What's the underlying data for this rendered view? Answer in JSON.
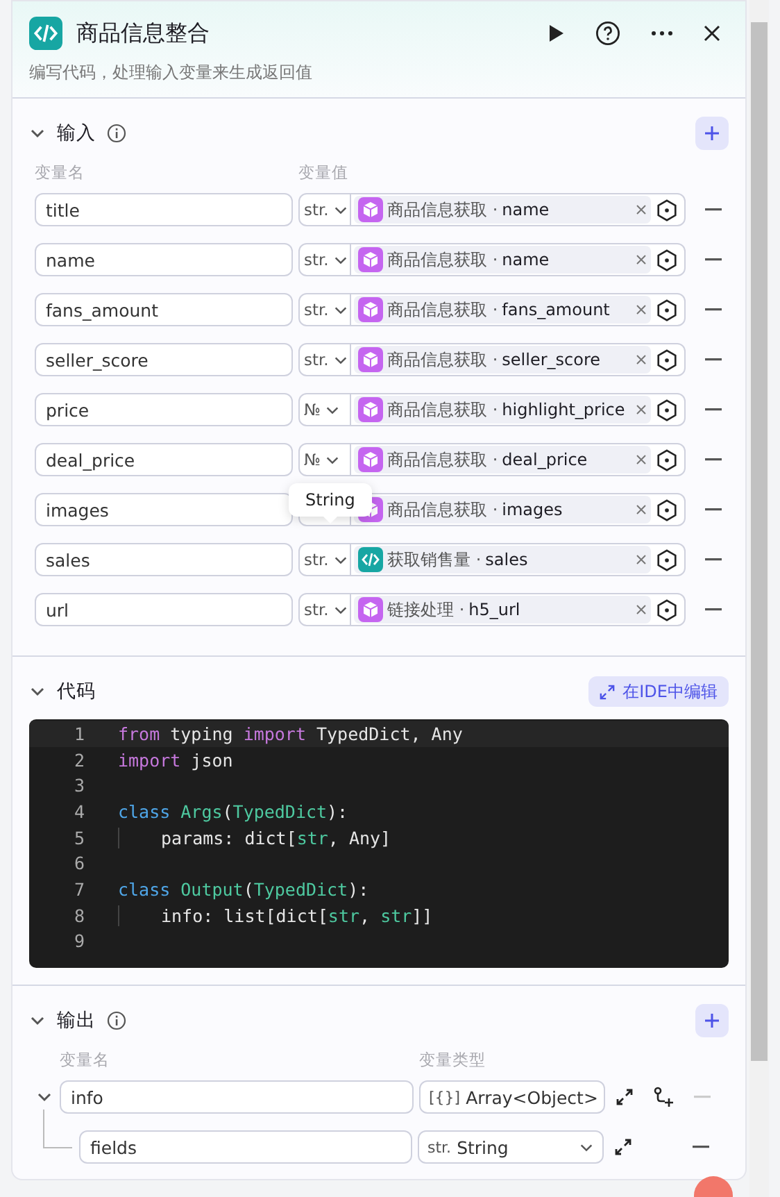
{
  "header": {
    "title": "商品信息整合",
    "description": "编写代码，处理输入变量来生成返回值"
  },
  "input": {
    "title": "输入",
    "expanded": true,
    "columns": [
      "变量名",
      "变量值"
    ],
    "rows": [
      {
        "name": "title",
        "type": "str.",
        "kind": "block",
        "source": "商品信息获取 ·",
        "field": "name"
      },
      {
        "name": "name",
        "type": "str.",
        "kind": "block",
        "source": "商品信息获取 ·",
        "field": "name"
      },
      {
        "name": "fans_amount",
        "type": "str.",
        "kind": "block",
        "source": "商品信息获取 ·",
        "field": "fans_amount"
      },
      {
        "name": "seller_score",
        "type": "str.",
        "kind": "block",
        "source": "商品信息获取 ·",
        "field": "seller_score"
      },
      {
        "name": "price",
        "type": "№",
        "kind": "block",
        "source": "商品信息获取 ·",
        "field": "highlight_price"
      },
      {
        "name": "deal_price",
        "type": "№",
        "kind": "block",
        "source": "商品信息获取 ·",
        "field": "deal_price"
      },
      {
        "name": "images",
        "kind": "block",
        "source": "商品信息获取 ·",
        "field": "images"
      },
      {
        "name": "sales",
        "type": "str.",
        "kind": "code",
        "source": "获取销售量 ·",
        "field": "sales",
        "tooltip": "String"
      },
      {
        "name": "url",
        "type": "str.",
        "kind": "block",
        "source": "链接处理 ·",
        "field": "h5_url"
      }
    ]
  },
  "code": {
    "title": "代码",
    "expanded": true,
    "ide_button": "在IDE中编辑",
    "lines": [
      {
        "number": "1",
        "tokens": [
          {
            "kind": "keyword",
            "text": "from"
          },
          {
            "kind": "plain",
            "text": " typing "
          },
          {
            "kind": "keyword",
            "text": "import"
          },
          {
            "kind": "plain",
            "text": " TypedDict, Any"
          }
        ]
      },
      {
        "number": "2",
        "tokens": [
          {
            "kind": "keyword",
            "text": "import"
          },
          {
            "kind": "plain",
            "text": " json"
          }
        ]
      },
      {
        "number": "3"
      },
      {
        "number": "4",
        "tokens": [
          {
            "kind": "storage",
            "text": "class "
          },
          {
            "kind": "type",
            "text": "Args"
          },
          {
            "kind": "plain",
            "text": "("
          },
          {
            "kind": "type",
            "text": "TypedDict"
          },
          {
            "kind": "plain",
            "text": "):"
          }
        ]
      },
      {
        "number": "5",
        "indent": true,
        "tokens": [
          {
            "kind": "plain",
            "text": "params: dict["
          },
          {
            "kind": "type",
            "text": "str"
          },
          {
            "kind": "plain",
            "text": ", Any]"
          }
        ]
      },
      {
        "number": "6"
      },
      {
        "number": "7",
        "tokens": [
          {
            "kind": "storage",
            "text": "class "
          },
          {
            "kind": "type",
            "text": "Output"
          },
          {
            "kind": "plain",
            "text": "("
          },
          {
            "kind": "type",
            "text": "TypedDict"
          },
          {
            "kind": "plain",
            "text": "):"
          }
        ]
      },
      {
        "number": "8",
        "indent": true,
        "tokens": [
          {
            "kind": "plain",
            "text": "info: list[dict["
          },
          {
            "kind": "type",
            "text": "str"
          },
          {
            "kind": "plain",
            "text": ", "
          },
          {
            "kind": "type",
            "text": "str"
          },
          {
            "kind": "plain",
            "text": "]]"
          }
        ]
      },
      {
        "number": "9"
      }
    ]
  },
  "output": {
    "title": "输出",
    "expanded": true,
    "columns": [
      "变量名",
      "变量类型"
    ],
    "rows": [
      {
        "name": "info",
        "type_icon": "[{}]",
        "type": "Array<Object>",
        "expanded": true,
        "can_add_child": true,
        "removable": false,
        "children": [
          {
            "name": "fields",
            "type_icon": "str.",
            "type": "String",
            "can_add_child": false,
            "removable": true
          }
        ]
      }
    ]
  }
}
